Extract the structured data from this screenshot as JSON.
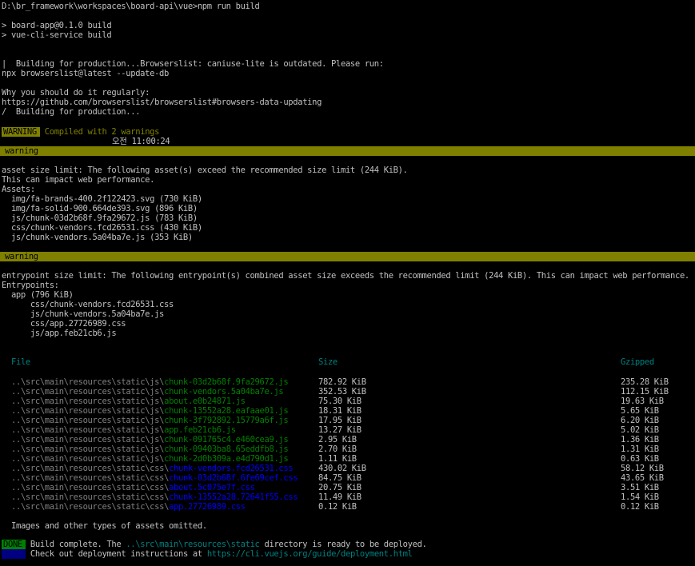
{
  "command_line": "D:\\br_framework\\workspaces\\board-api\\vue>npm run build",
  "npm_lines": [
    "> board-app@0.1.0 build",
    "> vue-cli-service build"
  ],
  "browserslist_lines": [
    "|  Building for production...Browserslist: caniuse-lite is outdated. Please run:",
    "npx browserslist@latest --update-db",
    "",
    "Why you should do it regularly:",
    "https://github.com/browserslist/browserslist#browsers-data-updating",
    "/  Building for production..."
  ],
  "compiled": {
    "badge": "WARNING",
    "text": "Compiled with 2 warnings",
    "time": "오전 11:00:24"
  },
  "warning1": {
    "label": " warning",
    "lines": [
      "asset size limit: The following asset(s) exceed the recommended size limit (244 KiB).",
      "This can impact web performance.",
      "Assets:",
      "  img/fa-brands-400.2f122423.svg (730 KiB)",
      "  img/fa-solid-900.664de393.svg (896 KiB)",
      "  js/chunk-03d2b68f.9fa29672.js (783 KiB)",
      "  css/chunk-vendors.fcd26531.css (430 KiB)",
      "  js/chunk-vendors.5a04ba7e.js (353 KiB)"
    ]
  },
  "warning2": {
    "label": " warning",
    "lines": [
      "entrypoint size limit: The following entrypoint(s) combined asset size exceeds the recommended limit (244 KiB). This can impact web performance.",
      "Entrypoints:",
      "  app (796 KiB)",
      "      css/chunk-vendors.fcd26531.css",
      "      js/chunk-vendors.5a04ba7e.js",
      "      css/app.27726989.css",
      "      js/app.feb21cb6.js"
    ]
  },
  "table": {
    "headers": {
      "file": "File",
      "size": "Size",
      "gzipped": "Gzipped"
    },
    "rows": [
      {
        "prefix": "..\\src\\main\\resources\\static\\js\\",
        "name": "chunk-03d2b68f.9fa29672.js",
        "size": "782.92 KiB",
        "gz": "235.28 KiB",
        "kind": "js"
      },
      {
        "prefix": "..\\src\\main\\resources\\static\\js\\",
        "name": "chunk-vendors.5a04ba7e.js",
        "size": "352.53 KiB",
        "gz": "112.15 KiB",
        "kind": "js"
      },
      {
        "prefix": "..\\src\\main\\resources\\static\\js\\",
        "name": "about.e0b24871.js",
        "size": "75.30 KiB",
        "gz": "19.63 KiB",
        "kind": "js"
      },
      {
        "prefix": "..\\src\\main\\resources\\static\\js\\",
        "name": "chunk-13552a28.eafaae01.js",
        "size": "18.31 KiB",
        "gz": "5.65 KiB",
        "kind": "js"
      },
      {
        "prefix": "..\\src\\main\\resources\\static\\js\\",
        "name": "chunk-3f792892.15779a6f.js",
        "size": "17.95 KiB",
        "gz": "6.20 KiB",
        "kind": "js"
      },
      {
        "prefix": "..\\src\\main\\resources\\static\\js\\",
        "name": "app.feb21cb6.js",
        "size": "13.27 KiB",
        "gz": "5.02 KiB",
        "kind": "js"
      },
      {
        "prefix": "..\\src\\main\\resources\\static\\js\\",
        "name": "chunk-091765c4.e460cea9.js",
        "size": "2.95 KiB",
        "gz": "1.36 KiB",
        "kind": "js"
      },
      {
        "prefix": "..\\src\\main\\resources\\static\\js\\",
        "name": "chunk-09403ba8.65eddfb8.js",
        "size": "2.70 KiB",
        "gz": "1.31 KiB",
        "kind": "js"
      },
      {
        "prefix": "..\\src\\main\\resources\\static\\js\\",
        "name": "chunk-2d0b309a.e4d790d1.js",
        "size": "1.11 KiB",
        "gz": "0.63 KiB",
        "kind": "js"
      },
      {
        "prefix": "..\\src\\main\\resources\\static\\css\\",
        "name": "chunk-vendors.fcd26531.css",
        "size": "430.02 KiB",
        "gz": "58.12 KiB",
        "kind": "css"
      },
      {
        "prefix": "..\\src\\main\\resources\\static\\css\\",
        "name": "chunk-03d2b68f.6fe69cef.css",
        "size": "84.75 KiB",
        "gz": "43.65 KiB",
        "kind": "css"
      },
      {
        "prefix": "..\\src\\main\\resources\\static\\css\\",
        "name": "about.5c075e7f.css",
        "size": "20.75 KiB",
        "gz": "3.51 KiB",
        "kind": "css"
      },
      {
        "prefix": "..\\src\\main\\resources\\static\\css\\",
        "name": "chunk-13552a28.72641f55.css",
        "size": "11.49 KiB",
        "gz": "1.54 KiB",
        "kind": "css"
      },
      {
        "prefix": "..\\src\\main\\resources\\static\\css\\",
        "name": "app.27726989.css",
        "size": "0.12 KiB",
        "gz": "0.12 KiB",
        "kind": "css"
      }
    ],
    "footnote": "Images and other types of assets omitted."
  },
  "done": {
    "badge": "DONE",
    "pre": "Build complete. The ",
    "dir": "..\\src\\main\\resources\\static",
    "post": " directory is ready to be deployed.",
    "info_badge": "INFO",
    "info_pre": "Check out deployment instructions at ",
    "info_url": "https://cli.vuejs.org/guide/deployment.html"
  },
  "colors": {
    "background": "#000000",
    "text": "#c0c0c0",
    "warning_bar": "#808000",
    "js_file": "#008000",
    "css_file": "#0000ff",
    "header": "#008080",
    "done_badge": "#008000",
    "info_badge": "#000080"
  }
}
